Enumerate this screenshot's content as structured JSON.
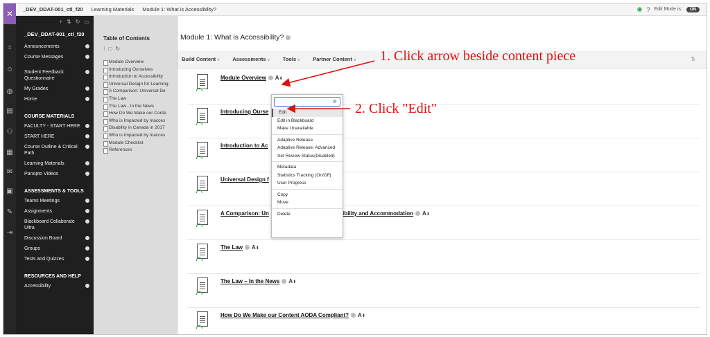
{
  "topbar": {
    "crumbs": [
      "_DEV_DDAT-001_ctl_f20",
      "Learning Materials",
      "Module 1: What is Accessibility?"
    ],
    "edit_mode_label": "Edit Mode is:",
    "edit_mode_value": "ON"
  },
  "course_menu": {
    "course": "_DEV_DDAT-001_ctl_f20",
    "items_a": [
      "Announcements",
      "Course Messages",
      "Student Feedback Questionnaire",
      "My Grades",
      "Home"
    ],
    "section1": "COURSE MATERIALS",
    "items_b": [
      "FACULTY - START HERE",
      "START HERE",
      "Course Outline & Critical Path",
      "Learning Materials",
      "Panopto Videos"
    ],
    "section2": "ASSESSMENTS & TOOLS",
    "items_c": [
      "Teams Meetings",
      "Assignments",
      "Blackboard Collaborate Ultra",
      "Discussion Board",
      "Groups",
      "Tests and Quizzes"
    ],
    "section3": "RESOURCES AND HELP",
    "items_d": [
      "Accessibility"
    ]
  },
  "toc": {
    "title": "Table of Contents",
    "items": [
      "Module Overview",
      "Introducing Ourselves",
      "Introduction to Accessibility",
      "Universal Design for Learning",
      "A Comparison: Universal De",
      "The Law",
      "The Law - In the News",
      "How Do We Make our Conte",
      "Who is Impacted by Inacces",
      "Disability in Canada in 2017",
      "Who is Impacted by Inacces",
      "Module Checklist",
      "References"
    ]
  },
  "main": {
    "title": "Module 1: What is Accessibility?",
    "toolbar": [
      "Build Content",
      "Assessments",
      "Tools",
      "Partner Content"
    ],
    "items": [
      "Module Overview",
      "Introducing Ourse",
      "Introduction to Ac",
      "Universal Design f",
      "A Comparison: Un",
      "The Law",
      "The Law – In the News",
      "How Do We Make our Content AODA Compliant?"
    ],
    "items_tail": [
      "",
      "",
      "",
      "ility",
      "ing, Accessibility and Accommodation",
      "",
      "",
      ""
    ]
  },
  "context_menu": {
    "items": [
      "Edit",
      "Edit in Blackboard",
      "Make Unavailable",
      "Adaptive Release",
      "Adaptive Release: Advanced",
      "Set Review Status(Disabled)",
      "Metadata",
      "Statistics Tracking (On/Off)",
      "User Progress",
      "Copy",
      "Move",
      "Delete"
    ]
  },
  "annotations": {
    "step1": "1. Click arrow beside content piece",
    "step2": "2. Click \"Edit\"",
    "color": "#e01010"
  }
}
